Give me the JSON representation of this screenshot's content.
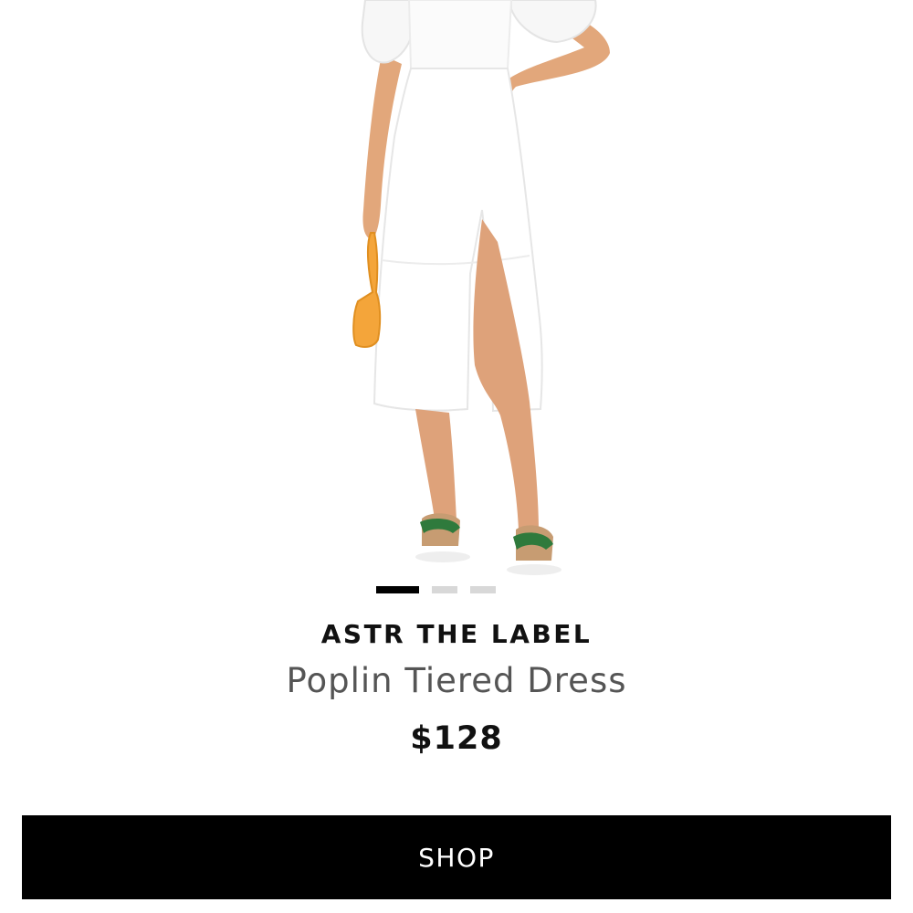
{
  "product": {
    "brand": "ASTR THE LABEL",
    "name": "Poplin Tiered Dress",
    "price": "$128"
  },
  "carousel": {
    "total_images": 3,
    "active_index": 0
  },
  "actions": {
    "shop_label": "SHOP"
  },
  "colors": {
    "button_bg": "#000000",
    "button_text": "#ffffff",
    "dot_active": "#000000",
    "dot_inactive": "#d8d8d8",
    "brand_text": "#111111",
    "name_text": "#555555"
  }
}
